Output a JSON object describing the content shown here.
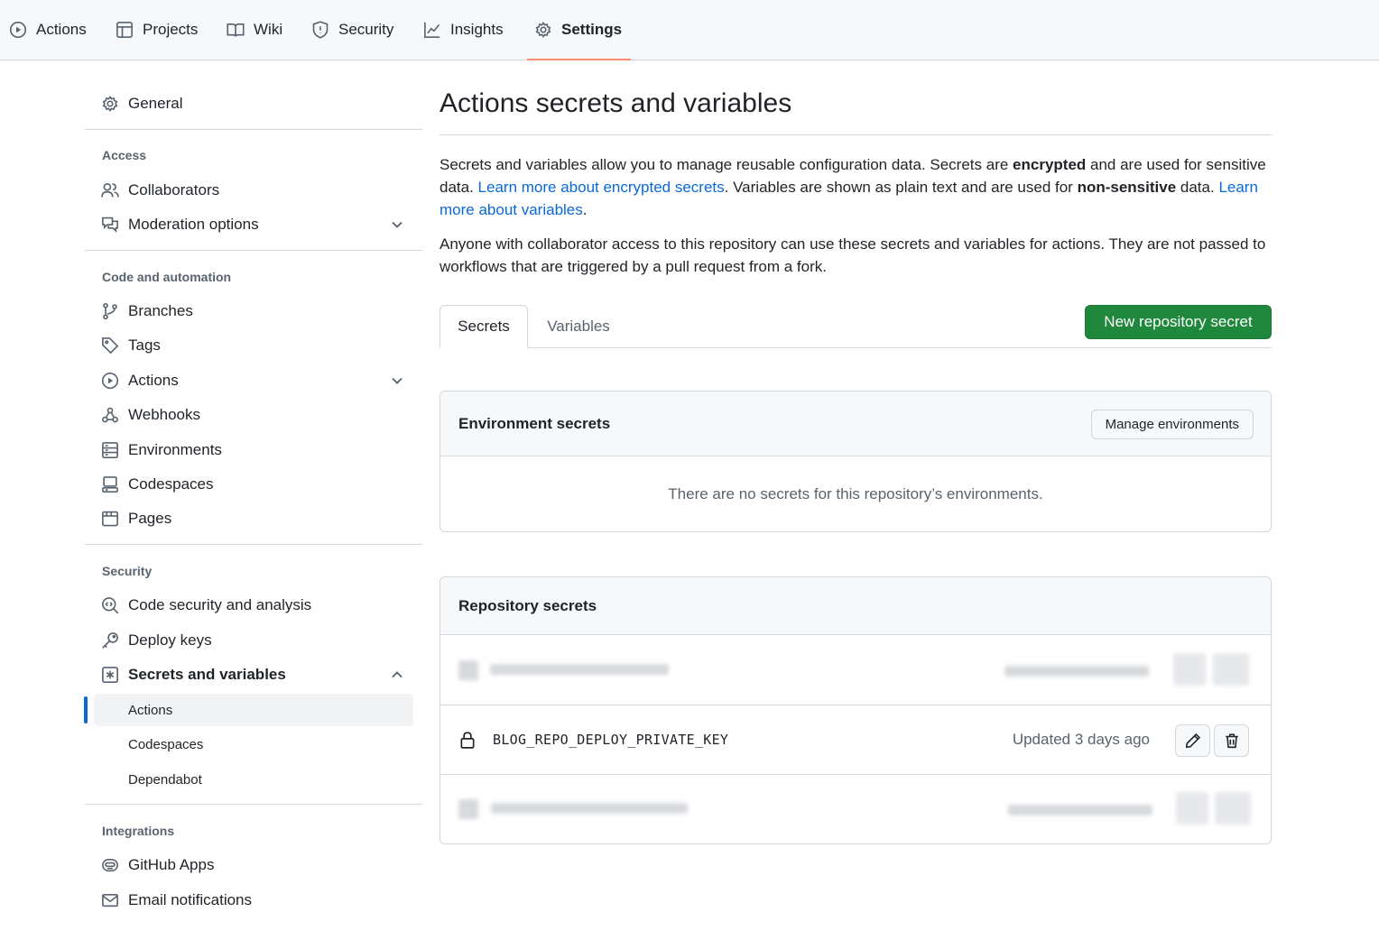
{
  "colors": {
    "accent": "#0969da",
    "primary_button": "#1f883d",
    "active_tab_underline": "#fd8c73",
    "muted_text": "#59636e",
    "border": "#d0d7de"
  },
  "topnav": {
    "tabs": [
      {
        "label": "Actions",
        "icon": "play-icon"
      },
      {
        "label": "Projects",
        "icon": "table-icon"
      },
      {
        "label": "Wiki",
        "icon": "book-icon"
      },
      {
        "label": "Security",
        "icon": "shield-icon"
      },
      {
        "label": "Insights",
        "icon": "graph-icon"
      },
      {
        "label": "Settings",
        "icon": "gear-icon",
        "active": true
      }
    ]
  },
  "sidebar": {
    "general": "General",
    "access": {
      "heading": "Access",
      "items": [
        "Collaborators",
        "Moderation options"
      ]
    },
    "code_automation": {
      "heading": "Code and automation",
      "items": [
        "Branches",
        "Tags",
        "Actions",
        "Webhooks",
        "Environments",
        "Codespaces",
        "Pages"
      ]
    },
    "security": {
      "heading": "Security",
      "items": [
        "Code security and analysis",
        "Deploy keys",
        "Secrets and variables"
      ],
      "subitems": [
        "Actions",
        "Codespaces",
        "Dependabot"
      ],
      "current_subitem": "Actions"
    },
    "integrations": {
      "heading": "Integrations",
      "items": [
        "GitHub Apps",
        "Email notifications"
      ]
    }
  },
  "main": {
    "title": "Actions secrets and variables",
    "intro": {
      "p1_a": "Secrets and variables allow you to manage reusable configuration data. Secrets are ",
      "p1_b": "encrypted",
      "p1_c": " and are used for sensitive data. ",
      "p1_link1": "Learn more about encrypted secrets",
      "p1_d": ". Variables are shown as plain text and are used for ",
      "p1_e": "non-sensitive",
      "p1_f": " data. ",
      "p1_link2": "Learn more about variables",
      "p1_g": ".",
      "p2": "Anyone with collaborator access to this repository can use these secrets and variables for actions. They are not passed to workflows that are triggered by a pull request from a fork."
    },
    "tabs": {
      "secrets": "Secrets",
      "variables": "Variables"
    },
    "new_secret_button": "New repository secret",
    "environment_secrets": {
      "heading": "Environment secrets",
      "manage_button": "Manage environments",
      "empty_text": "There are no secrets for this repository’s environments."
    },
    "repository_secrets": {
      "heading": "Repository secrets",
      "visible_secret": {
        "name": "BLOG_REPO_DEPLOY_PRIVATE_KEY",
        "updated": "Updated 3 days ago"
      }
    }
  }
}
